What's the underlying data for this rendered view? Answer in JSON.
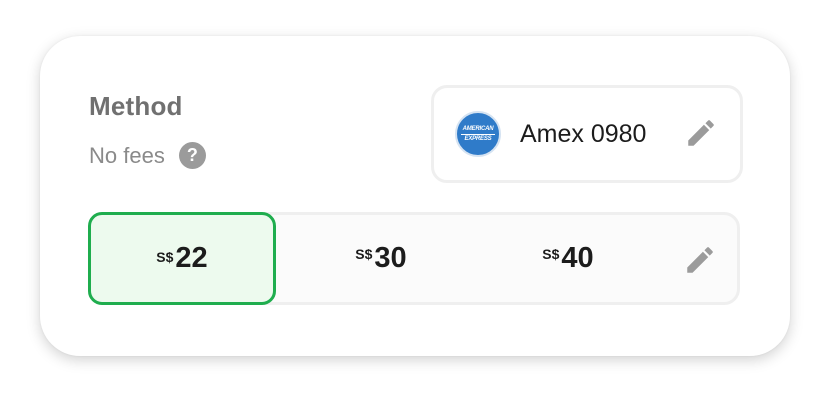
{
  "method": {
    "title": "Method",
    "fees_text": "No fees",
    "help_icon": "question-mark-icon",
    "help_glyph": "?"
  },
  "payment": {
    "card_brand": "American Express",
    "logo_text_top": "AMERICAN",
    "logo_text_bottom": "EXPRESS",
    "card_label": "Amex 0980",
    "edit_icon": "pencil-icon"
  },
  "amounts": {
    "currency": "S$",
    "options": [
      {
        "value": "22",
        "selected": true
      },
      {
        "value": "30",
        "selected": false
      },
      {
        "value": "40",
        "selected": false
      }
    ],
    "edit_icon": "pencil-icon"
  },
  "colors": {
    "selected_border": "#1fad4e",
    "selected_bg": "#edfaee",
    "amex_blue": "#2f7bc9",
    "icon_gray": "#9b9b9b"
  }
}
